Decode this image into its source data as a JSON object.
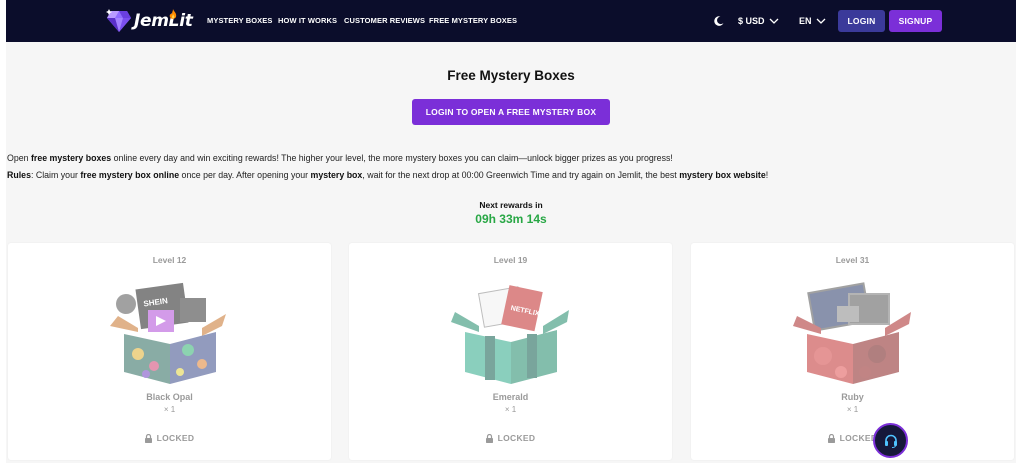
{
  "header": {
    "brand": "JemLit",
    "nav": [
      "MYSTERY BOXES",
      "HOW IT WORKS",
      "CUSTOMER REVIEWS",
      "FREE MYSTERY BOXES"
    ],
    "currency": "$ USD",
    "language": "EN",
    "login_label": "LOGIN",
    "signup_label": "SIGNUP"
  },
  "main": {
    "title": "Free Mystery Boxes",
    "cta_label": "LOGIN TO OPEN A FREE MYSTERY BOX",
    "intro": {
      "t1": "Open ",
      "b1": "free mystery boxes",
      "t2": " online every day and win exciting rewards! The higher your level, the more mystery boxes you can claim—unlock bigger prizes as you progress!"
    },
    "rules": {
      "b0": "Rules",
      "t1": ": Claim your ",
      "b1": "free mystery box online",
      "t2": " once per day. After opening your ",
      "b2": "mystery box",
      "t3": ", wait for the next drop at 00:00 Greenwich Time and try again on Jemlit, the best ",
      "b3": "mystery box website",
      "t4": "!"
    },
    "next_label": "Next rewards in",
    "countdown": "09h 33m 14s"
  },
  "boxes": [
    {
      "level": "Level 12",
      "name": "Black Opal",
      "qty": "× 1",
      "status": "LOCKED"
    },
    {
      "level": "Level 19",
      "name": "Emerald",
      "qty": "× 1",
      "status": "LOCKED"
    },
    {
      "level": "Level 31",
      "name": "Ruby",
      "qty": "× 1",
      "status": "LOCKED"
    }
  ],
  "colors": {
    "navbar": "#0b0d2b",
    "primary": "#7b2fd8",
    "login": "#3b3a9a",
    "countdown": "#28a745"
  },
  "icons": [
    "gem-logo-icon",
    "flame-icon",
    "moon-icon",
    "chevron-down-icon",
    "lock-icon",
    "headset-icon"
  ]
}
